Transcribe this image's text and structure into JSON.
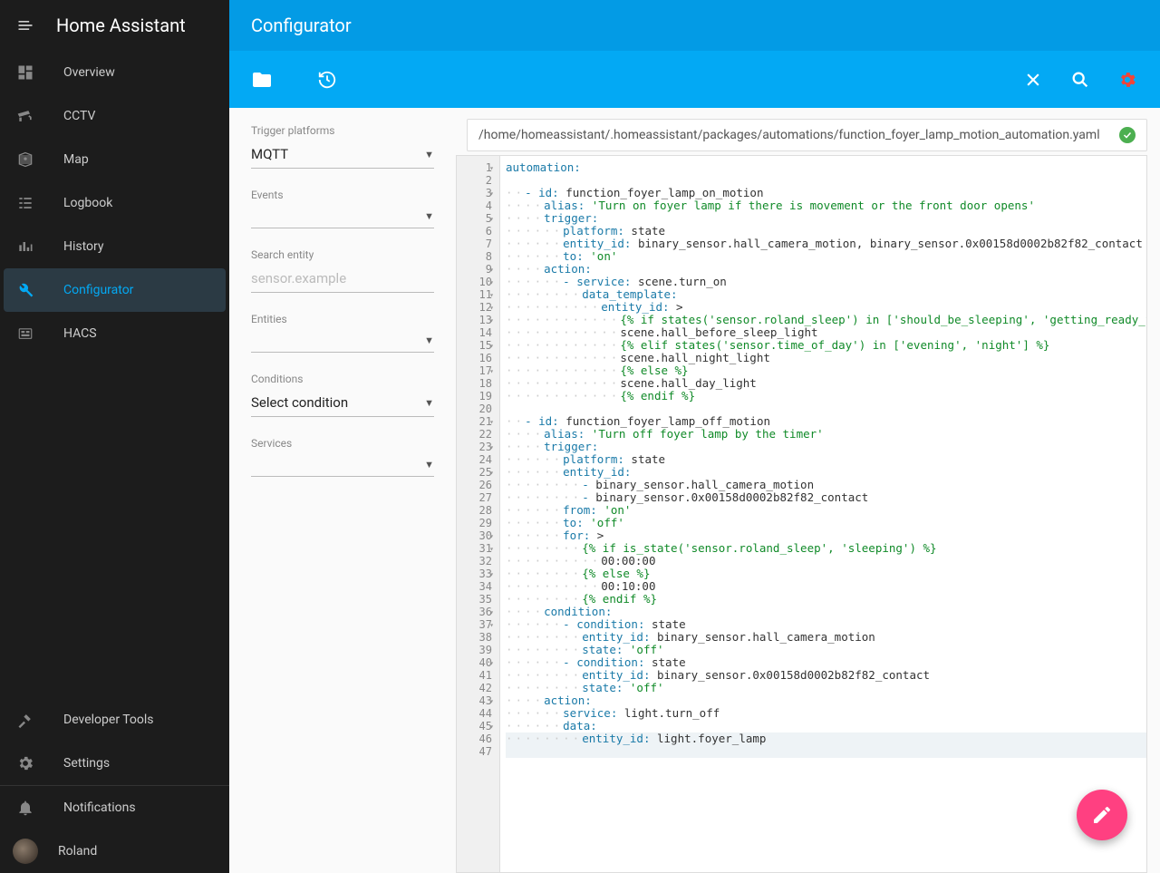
{
  "app_title": "Home Assistant",
  "page_title": "Configurator",
  "sidebar": {
    "items": [
      {
        "label": "Overview",
        "icon": "dashboard"
      },
      {
        "label": "CCTV",
        "icon": "cctv"
      },
      {
        "label": "Map",
        "icon": "map"
      },
      {
        "label": "Logbook",
        "icon": "logbook"
      },
      {
        "label": "History",
        "icon": "history"
      },
      {
        "label": "Configurator",
        "icon": "wrench",
        "selected": true
      },
      {
        "label": "HACS",
        "icon": "hacs"
      }
    ],
    "bottom_items": [
      {
        "label": "Developer Tools",
        "icon": "hammer"
      },
      {
        "label": "Settings",
        "icon": "gear"
      }
    ],
    "notifications": "Notifications",
    "user": "Roland"
  },
  "sidepanel": {
    "trigger_platforms": {
      "label": "Trigger platforms",
      "value": "MQTT"
    },
    "events": {
      "label": "Events",
      "value": ""
    },
    "search_entity": {
      "label": "Search entity",
      "placeholder": "sensor.example"
    },
    "entities": {
      "label": "Entities",
      "value": ""
    },
    "conditions": {
      "label": "Conditions",
      "value": "Select condition"
    },
    "services": {
      "label": "Services",
      "value": ""
    }
  },
  "file_path": "/home/homeassistant/.homeassistant/packages/automations/function_foyer_lamp_motion_automation.yaml",
  "code_lines": [
    {
      "n": 1,
      "fold": true,
      "tokens": [
        [
          "key",
          "automation:"
        ]
      ]
    },
    {
      "n": 2,
      "tokens": []
    },
    {
      "n": 3,
      "fold": true,
      "tokens": [
        [
          "dot",
          "··"
        ],
        [
          "dash",
          "- "
        ],
        [
          "key",
          "id:"
        ],
        [
          "txt",
          " function_foyer_lamp_on_motion"
        ]
      ]
    },
    {
      "n": 4,
      "tokens": [
        [
          "dot",
          "····"
        ],
        [
          "key",
          "alias:"
        ],
        [
          "txt",
          " "
        ],
        [
          "str",
          "'Turn on foyer lamp if there is movement or the front door opens'"
        ]
      ]
    },
    {
      "n": 5,
      "fold": true,
      "tokens": [
        [
          "dot",
          "····"
        ],
        [
          "key",
          "trigger:"
        ]
      ]
    },
    {
      "n": 6,
      "tokens": [
        [
          "dot",
          "······"
        ],
        [
          "key",
          "platform:"
        ],
        [
          "txt",
          " state"
        ]
      ]
    },
    {
      "n": 7,
      "tokens": [
        [
          "dot",
          "······"
        ],
        [
          "key",
          "entity_id:"
        ],
        [
          "txt",
          " binary_sensor.hall_camera_motion, binary_sensor.0x00158d0002b82f82_contact"
        ]
      ]
    },
    {
      "n": 8,
      "tokens": [
        [
          "dot",
          "······"
        ],
        [
          "key",
          "to:"
        ],
        [
          "txt",
          " "
        ],
        [
          "str",
          "'on'"
        ]
      ]
    },
    {
      "n": 9,
      "fold": true,
      "tokens": [
        [
          "dot",
          "····"
        ],
        [
          "key",
          "action:"
        ]
      ]
    },
    {
      "n": 10,
      "fold": true,
      "tokens": [
        [
          "dot",
          "······"
        ],
        [
          "dash",
          "- "
        ],
        [
          "key",
          "service:"
        ],
        [
          "txt",
          " scene.turn_on"
        ]
      ]
    },
    {
      "n": 11,
      "fold": true,
      "tokens": [
        [
          "dot",
          "········"
        ],
        [
          "key",
          "data_template:"
        ]
      ]
    },
    {
      "n": 12,
      "fold": true,
      "tokens": [
        [
          "dot",
          "··········"
        ],
        [
          "key",
          "entity_id:"
        ],
        [
          "txt",
          " >"
        ]
      ]
    },
    {
      "n": 13,
      "fold": true,
      "tokens": [
        [
          "dot",
          "············"
        ],
        [
          "tmpl",
          "{% if states('sensor.roland_sleep') in ['should_be_sleeping', 'getting_ready_for_bed', '"
        ]
      ]
    },
    {
      "n": 14,
      "tokens": [
        [
          "dot",
          "············"
        ],
        [
          "txt",
          "scene.hall_before_sleep_light"
        ]
      ]
    },
    {
      "n": 15,
      "fold": true,
      "tokens": [
        [
          "dot",
          "············"
        ],
        [
          "tmpl",
          "{% elif states('sensor.time_of_day') in ['evening', 'night'] %}"
        ]
      ]
    },
    {
      "n": 16,
      "tokens": [
        [
          "dot",
          "············"
        ],
        [
          "txt",
          "scene.hall_night_light"
        ]
      ]
    },
    {
      "n": 17,
      "fold": true,
      "tokens": [
        [
          "dot",
          "············"
        ],
        [
          "tmpl",
          "{% else %}"
        ]
      ]
    },
    {
      "n": 18,
      "tokens": [
        [
          "dot",
          "············"
        ],
        [
          "txt",
          "scene.hall_day_light"
        ]
      ]
    },
    {
      "n": 19,
      "tokens": [
        [
          "dot",
          "············"
        ],
        [
          "tmpl",
          "{% endif %}"
        ]
      ]
    },
    {
      "n": 20,
      "tokens": []
    },
    {
      "n": 21,
      "fold": true,
      "tokens": [
        [
          "dot",
          "··"
        ],
        [
          "dash",
          "- "
        ],
        [
          "key",
          "id:"
        ],
        [
          "txt",
          " function_foyer_lamp_off_motion"
        ]
      ]
    },
    {
      "n": 22,
      "tokens": [
        [
          "dot",
          "····"
        ],
        [
          "key",
          "alias:"
        ],
        [
          "txt",
          " "
        ],
        [
          "str",
          "'Turn off foyer lamp by the timer'"
        ]
      ]
    },
    {
      "n": 23,
      "fold": true,
      "tokens": [
        [
          "dot",
          "····"
        ],
        [
          "key",
          "trigger:"
        ]
      ]
    },
    {
      "n": 24,
      "tokens": [
        [
          "dot",
          "······"
        ],
        [
          "key",
          "platform:"
        ],
        [
          "txt",
          " state"
        ]
      ]
    },
    {
      "n": 25,
      "fold": true,
      "tokens": [
        [
          "dot",
          "······"
        ],
        [
          "key",
          "entity_id:"
        ]
      ]
    },
    {
      "n": 26,
      "tokens": [
        [
          "dot",
          "········"
        ],
        [
          "dash",
          "- "
        ],
        [
          "txt",
          "binary_sensor.hall_camera_motion"
        ]
      ]
    },
    {
      "n": 27,
      "tokens": [
        [
          "dot",
          "········"
        ],
        [
          "dash",
          "- "
        ],
        [
          "txt",
          "binary_sensor.0x00158d0002b82f82_contact"
        ]
      ]
    },
    {
      "n": 28,
      "tokens": [
        [
          "dot",
          "······"
        ],
        [
          "key",
          "from:"
        ],
        [
          "txt",
          " "
        ],
        [
          "str",
          "'on'"
        ]
      ]
    },
    {
      "n": 29,
      "tokens": [
        [
          "dot",
          "······"
        ],
        [
          "key",
          "to:"
        ],
        [
          "txt",
          " "
        ],
        [
          "str",
          "'off'"
        ]
      ]
    },
    {
      "n": 30,
      "fold": true,
      "tokens": [
        [
          "dot",
          "······"
        ],
        [
          "key",
          "for:"
        ],
        [
          "txt",
          " >"
        ]
      ]
    },
    {
      "n": 31,
      "fold": true,
      "tokens": [
        [
          "dot",
          "········"
        ],
        [
          "tmpl",
          "{% if is_state('sensor.roland_sleep', 'sleeping') %}"
        ]
      ]
    },
    {
      "n": 32,
      "tokens": [
        [
          "dot",
          "··········"
        ],
        [
          "txt",
          "00:00:00"
        ]
      ]
    },
    {
      "n": 33,
      "fold": true,
      "tokens": [
        [
          "dot",
          "········"
        ],
        [
          "tmpl",
          "{% else %}"
        ]
      ]
    },
    {
      "n": 34,
      "tokens": [
        [
          "dot",
          "··········"
        ],
        [
          "txt",
          "00:10:00"
        ]
      ]
    },
    {
      "n": 35,
      "tokens": [
        [
          "dot",
          "········"
        ],
        [
          "tmpl",
          "{% endif %}"
        ]
      ]
    },
    {
      "n": 36,
      "fold": true,
      "tokens": [
        [
          "dot",
          "····"
        ],
        [
          "key",
          "condition:"
        ]
      ]
    },
    {
      "n": 37,
      "fold": true,
      "tokens": [
        [
          "dot",
          "······"
        ],
        [
          "dash",
          "- "
        ],
        [
          "key",
          "condition:"
        ],
        [
          "txt",
          " state"
        ]
      ]
    },
    {
      "n": 38,
      "tokens": [
        [
          "dot",
          "········"
        ],
        [
          "key",
          "entity_id:"
        ],
        [
          "txt",
          " binary_sensor.hall_camera_motion"
        ]
      ]
    },
    {
      "n": 39,
      "tokens": [
        [
          "dot",
          "········"
        ],
        [
          "key",
          "state:"
        ],
        [
          "txt",
          " "
        ],
        [
          "str",
          "'off'"
        ]
      ]
    },
    {
      "n": 40,
      "fold": true,
      "tokens": [
        [
          "dot",
          "······"
        ],
        [
          "dash",
          "- "
        ],
        [
          "key",
          "condition:"
        ],
        [
          "txt",
          " state"
        ]
      ]
    },
    {
      "n": 41,
      "tokens": [
        [
          "dot",
          "········"
        ],
        [
          "key",
          "entity_id:"
        ],
        [
          "txt",
          " binary_sensor.0x00158d0002b82f82_contact"
        ]
      ]
    },
    {
      "n": 42,
      "tokens": [
        [
          "dot",
          "········"
        ],
        [
          "key",
          "state:"
        ],
        [
          "txt",
          " "
        ],
        [
          "str",
          "'off'"
        ]
      ]
    },
    {
      "n": 43,
      "fold": true,
      "tokens": [
        [
          "dot",
          "····"
        ],
        [
          "key",
          "action:"
        ]
      ]
    },
    {
      "n": 44,
      "tokens": [
        [
          "dot",
          "······"
        ],
        [
          "key",
          "service:"
        ],
        [
          "txt",
          " light.turn_off"
        ]
      ]
    },
    {
      "n": 45,
      "fold": true,
      "tokens": [
        [
          "dot",
          "······"
        ],
        [
          "key",
          "data:"
        ]
      ]
    },
    {
      "n": 46,
      "cursor": true,
      "tokens": [
        [
          "dot",
          "········"
        ],
        [
          "key",
          "entity_id:"
        ],
        [
          "txt",
          " light.foyer_lamp"
        ]
      ]
    },
    {
      "n": 47,
      "cursor": true,
      "tokens": []
    }
  ]
}
